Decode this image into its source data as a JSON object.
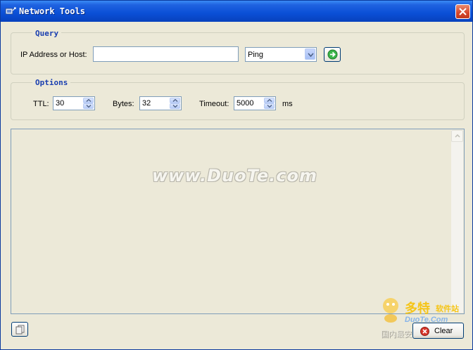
{
  "window": {
    "title": "Network Tools"
  },
  "query": {
    "group_title": "Query",
    "host_label": "IP Address or Host:",
    "host_value": "",
    "command_selected": "Ping"
  },
  "options": {
    "group_title": "Options",
    "ttl_label": "TTL:",
    "ttl_value": "30",
    "bytes_label": "Bytes:",
    "bytes_value": "32",
    "timeout_label": "Timeout:",
    "timeout_value": "5000",
    "timeout_unit": "ms"
  },
  "output": {
    "watermark": "www.DuoTe.com"
  },
  "footer": {
    "clear_label": "Clear",
    "logo_text_cn": "多特",
    "logo_text_cn_small": "软件站",
    "logo_text_en": "DuoTe.Com",
    "logo_text_tagline": "国内最安全的软件站"
  },
  "colors": {
    "titlebar": "#0a4fd6",
    "group_title": "#1a3fb0",
    "window_bg": "#ece9d8"
  },
  "icons": {
    "app": "network-app-icon",
    "close": "close-icon",
    "go": "go-arrow-icon",
    "copy": "copy-icon",
    "clear": "clear-icon"
  }
}
